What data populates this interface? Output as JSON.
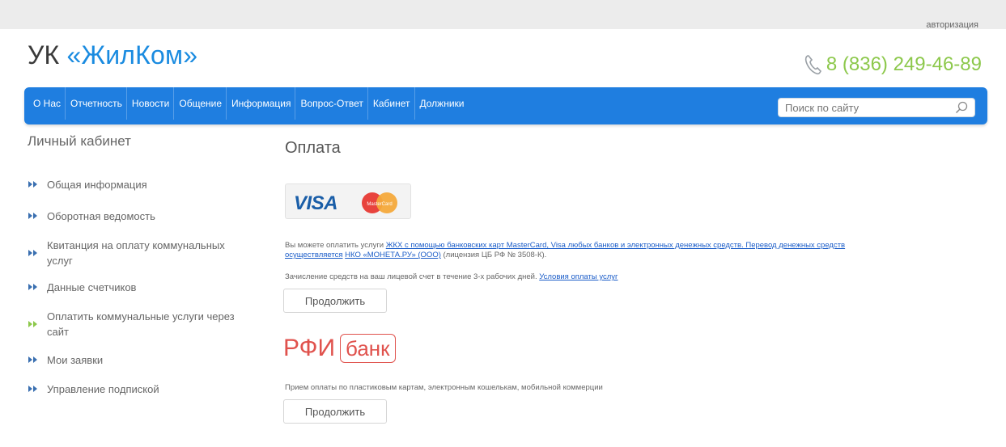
{
  "topbar": {
    "auth_label": "авторизация"
  },
  "logo": {
    "prefix": "УК ",
    "brand": "«ЖилКом»"
  },
  "phone": {
    "number": "8 (836) 249-46-89"
  },
  "nav": {
    "items": [
      {
        "label": "О Нас"
      },
      {
        "label": "Отчетность"
      },
      {
        "label": "Новости"
      },
      {
        "label": "Общение"
      },
      {
        "label": "Информация"
      },
      {
        "label": "Вопрос-Ответ"
      },
      {
        "label": "Кабинет"
      },
      {
        "label": "Должники"
      }
    ],
    "search_placeholder": "Поиск по сайту"
  },
  "sidebar": {
    "title": "Личный кабинет",
    "items": [
      {
        "label": "Общая информация"
      },
      {
        "label": "Оборотная ведомость"
      },
      {
        "label": "Квитанция на оплату коммунальных услуг"
      },
      {
        "label": "Данные счетчиков"
      },
      {
        "label": "Оплатить коммунальные услуги через сайт",
        "active": true
      },
      {
        "label": "Мои заявки"
      },
      {
        "label": "Управление подпиской"
      }
    ]
  },
  "main": {
    "title": "Оплата",
    "cards": {
      "visa": "VISA",
      "mastercard": "MasterCard"
    },
    "pay": {
      "text_prefix": "Вы можете оплатить услуги ",
      "link1": "ЖКХ с помощью банковских карт MasterCard, Visa любых банков и электронных денежных средств. Перевод денежных средств осуществляется",
      "text_mid": " ",
      "link2": "НКО «МОНЕТА.РУ» (ООО)",
      "text_suffix": " (лицензия ЦБ РФ № 3508-К).",
      "line2_text": "Зачисление средств на ваш лицевой счет в течение 3-х рабочих дней. ",
      "line2_link": "Условия оплаты услуг",
      "button": "Продолжить"
    },
    "rfi": {
      "name": "РФИ",
      "bank": "банк",
      "text": "Прием оплаты по пластиковым картам, электронным кошелькам, мобильной коммерции",
      "button": "Продолжить"
    }
  },
  "colors": {
    "nav_bg": "#1f7ee0",
    "brand_blue": "#1a8be0",
    "phone_green": "#8cc84b",
    "rfi_red": "#e0524d",
    "link_blue": "#1a5cc8"
  }
}
